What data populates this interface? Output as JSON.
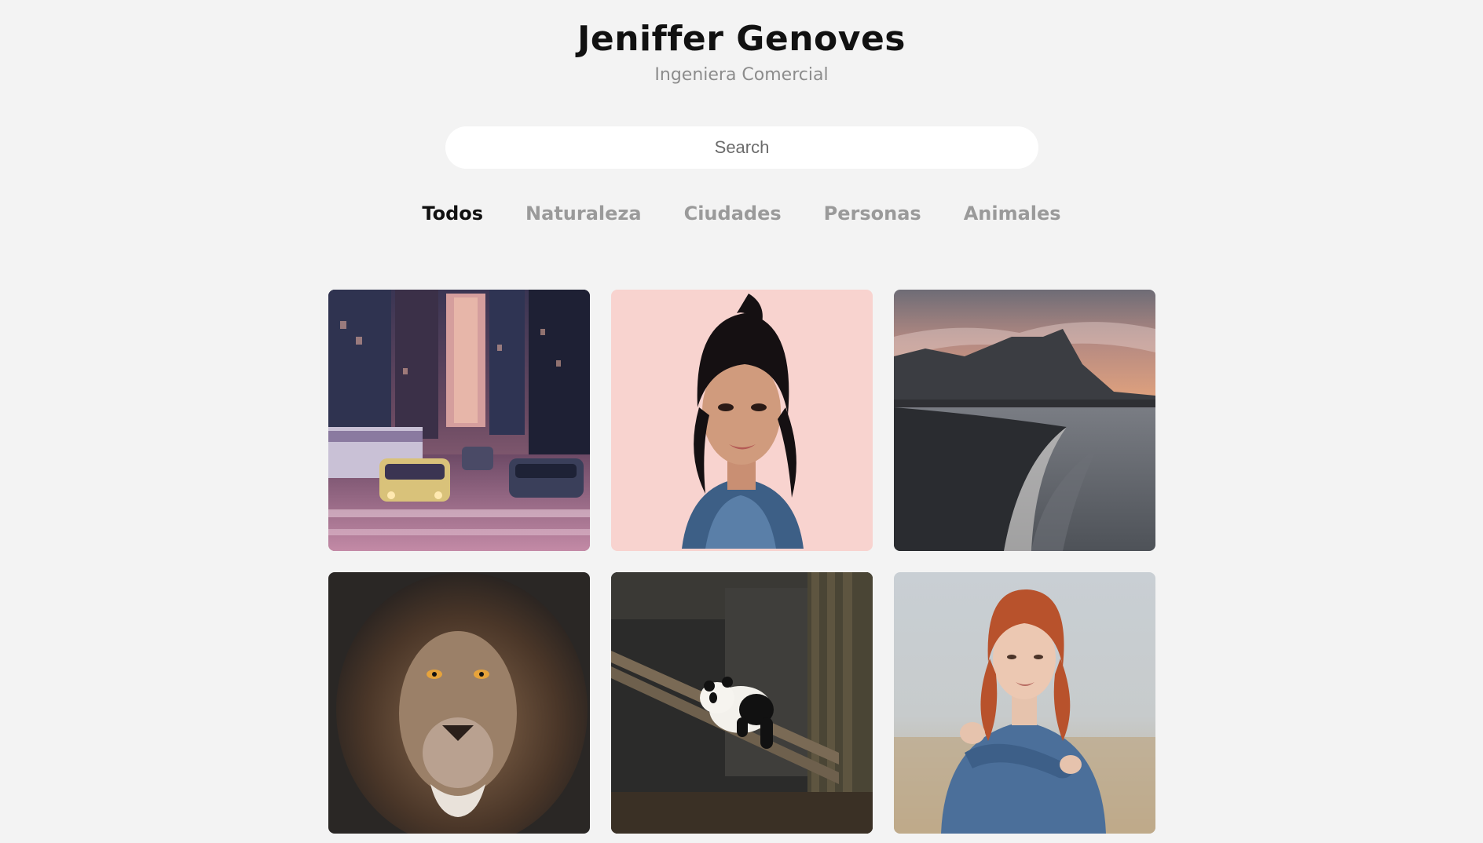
{
  "profile": {
    "name": "Jeniffer Genoves",
    "role": "Ingeniera Comercial"
  },
  "search": {
    "placeholder": "Search",
    "value": ""
  },
  "filters": [
    {
      "label": "Todos",
      "active": true
    },
    {
      "label": "Naturaleza",
      "active": false
    },
    {
      "label": "Ciudades",
      "active": false
    },
    {
      "label": "Personas",
      "active": false
    },
    {
      "label": "Animales",
      "active": false
    }
  ],
  "gallery": [
    {
      "subject": "city-street"
    },
    {
      "subject": "woman-pink-background"
    },
    {
      "subject": "mountain-coast-sunset"
    },
    {
      "subject": "lion-portrait"
    },
    {
      "subject": "panda-on-branch"
    },
    {
      "subject": "redhead-woman-field"
    }
  ]
}
